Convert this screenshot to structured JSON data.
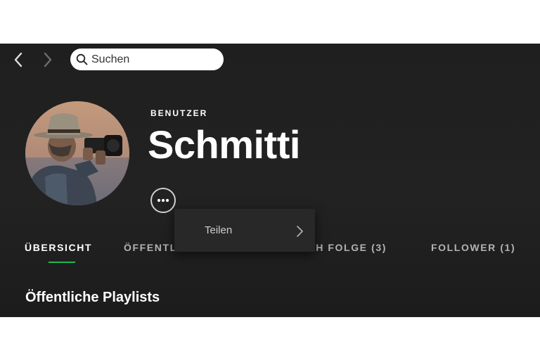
{
  "colors": {
    "background": "#1f1f1f",
    "text_primary": "#ffffff",
    "text_muted": "#b3b3b3",
    "accent": "#1db954",
    "menu_background": "#282828"
  },
  "navigation": {
    "back_icon": "chevron-left-icon",
    "forward_icon": "chevron-right-icon"
  },
  "search": {
    "icon": "search-icon",
    "placeholder": "Suchen",
    "value": ""
  },
  "profile": {
    "user_type": "BENUTZER",
    "name": "Schmitti",
    "avatar": "profile-photo",
    "more_icon": "more-options-icon"
  },
  "tabs": [
    {
      "label": "ÜBERSICHT",
      "active": true
    },
    {
      "label": "ÖFFENTLICHE PLAYLISTS",
      "active": false
    },
    {
      "label": "ICH FOLGE (3)",
      "active": false
    },
    {
      "label": "FOLLOWER (1)",
      "active": false
    }
  ],
  "context_menu": {
    "items": [
      {
        "label": "Teilen",
        "icon": "chevron-right-icon"
      }
    ]
  },
  "section": {
    "title": "Öffentliche Playlists"
  }
}
